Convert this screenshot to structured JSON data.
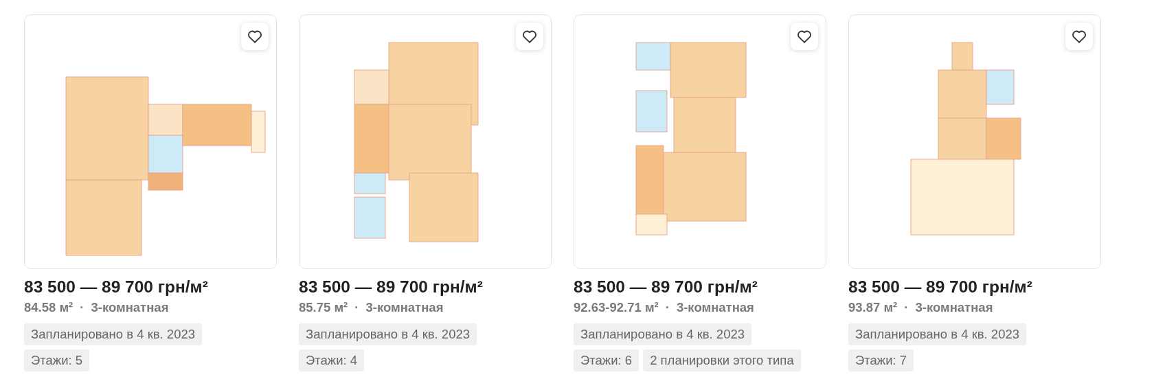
{
  "listings": [
    {
      "kind": "picture",
      "favorite": false,
      "price": "83 500 — 89 700 грн/м²",
      "area": "84.58 м²",
      "separator": "·",
      "rooms": "3-комнатная",
      "tags": [
        "Запланировано в 4 кв. 2023",
        "Этажи: 5"
      ]
    },
    {
      "kind": "picture",
      "favorite": false,
      "price": "83 500 — 89 700 грн/м²",
      "area": "85.75 м²",
      "separator": "·",
      "rooms": "3-комнатная",
      "tags": [
        "Запланировано в 4 кв. 2023",
        "Этажи: 4"
      ]
    },
    {
      "kind": "picture",
      "favorite": false,
      "price": "83 500 — 89 700 грн/м²",
      "area": "92.63-92.71 м²",
      "separator": "·",
      "rooms": "3-комнатная",
      "tags": [
        "Запланировано в 4 кв. 2023",
        "Этажи: 6",
        "2 планировки этого типа"
      ]
    },
    {
      "kind": "picture",
      "favorite": false,
      "price": "83 500 — 89 700 грн/м²",
      "area": "93.87 м²",
      "separator": "·",
      "rooms": "3-комнатная",
      "tags": [
        "Запланировано в 4 кв. 2023",
        "Этажи: 7"
      ]
    }
  ]
}
